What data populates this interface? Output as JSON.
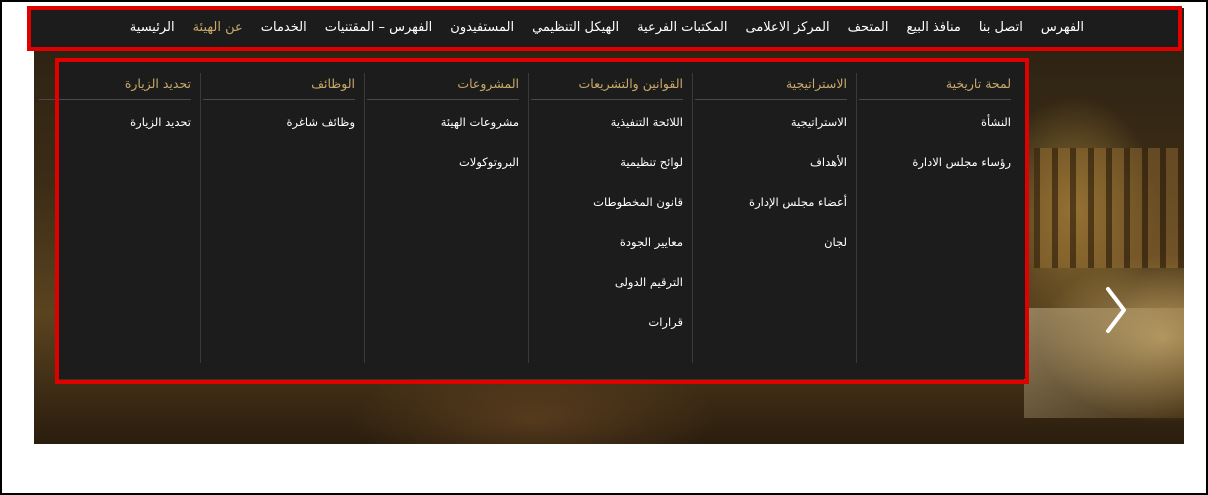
{
  "nav": {
    "items": [
      {
        "label": "الرئيسية",
        "active": false
      },
      {
        "label": "عن الهيئة",
        "active": true
      },
      {
        "label": "الخدمات",
        "active": false
      },
      {
        "label": "الفهرس – المقتنيات",
        "active": false
      },
      {
        "label": "المستفيدون",
        "active": false
      },
      {
        "label": "الهيكل التنظيمي",
        "active": false
      },
      {
        "label": "المكتبات الفرعية",
        "active": false
      },
      {
        "label": "المركز الاعلامى",
        "active": false
      },
      {
        "label": "المتحف",
        "active": false
      },
      {
        "label": "منافذ البيع",
        "active": false
      },
      {
        "label": "اتصل بنا",
        "active": false
      },
      {
        "label": "الفهرس",
        "active": false
      }
    ]
  },
  "mega_menu": {
    "columns": [
      {
        "title": "لمحة تاريخية",
        "links": [
          "النشأة",
          "رؤساء مجلس الادارة"
        ]
      },
      {
        "title": "الاستراتيجية",
        "links": [
          "الاستراتيجية",
          "الأهداف",
          "أعضاء مجلس الإدارة",
          "لجان"
        ]
      },
      {
        "title": "القوانين والتشريعات",
        "links": [
          "اللائحة التنفيذية",
          "لوائح تنظيمية",
          "قانون المخطوطات",
          "معايير الجودة",
          "الترقيم الدولى",
          "قرارات"
        ]
      },
      {
        "title": "المشروعات",
        "links": [
          "مشروعات الهيئة",
          "البروتوكولات"
        ]
      },
      {
        "title": "الوظائف",
        "links": [
          "وظائف شاغرة"
        ]
      },
      {
        "title": "تحديد الزيارة",
        "links": [
          "تحديد الزيارة"
        ]
      }
    ]
  },
  "colors": {
    "accent": "#c8a96a",
    "nav_bg": "#1c1c1c",
    "highlight": "#e00000"
  },
  "icons": {
    "slider_next": "chevron-right-icon"
  }
}
